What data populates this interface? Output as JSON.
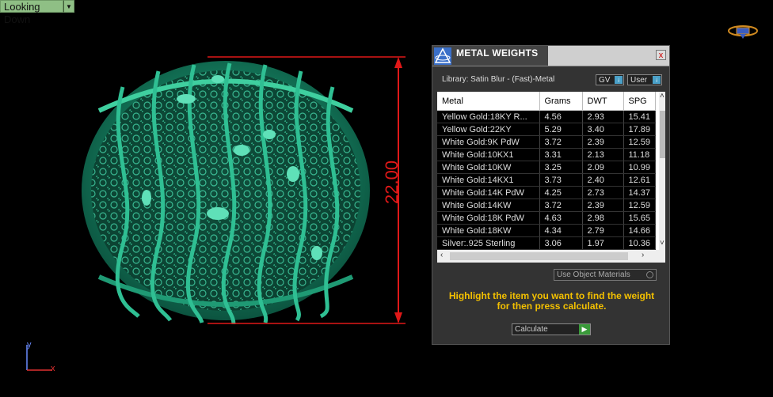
{
  "viewport": {
    "view_label": "Looking Down"
  },
  "dimension": {
    "value": "22.00"
  },
  "axis": {
    "y_label": "y",
    "x_label": "x"
  },
  "panel": {
    "title": "METAL WEIGHTS",
    "close_label": "x",
    "library": "Library: Satin Blur - (Fast)-Metal",
    "unit_select": "GV",
    "source_select": "User",
    "columns": [
      "Metal",
      "Grams",
      "DWT",
      "SPG"
    ],
    "rows": [
      [
        "Yellow Gold:18KY R...",
        "4.56",
        "2.93",
        "15.41"
      ],
      [
        "Yellow Gold:22KY",
        "5.29",
        "3.40",
        "17.89"
      ],
      [
        "White Gold:9K PdW",
        "3.72",
        "2.39",
        "12.59"
      ],
      [
        "White Gold:10KX1",
        "3.31",
        "2.13",
        "11.18"
      ],
      [
        "White Gold:10KW",
        "3.25",
        "2.09",
        "10.99"
      ],
      [
        "White Gold:14KX1",
        "3.73",
        "2.40",
        "12.61"
      ],
      [
        "White Gold:14K PdW",
        "4.25",
        "2.73",
        "14.37"
      ],
      [
        "White Gold:14KW",
        "3.72",
        "2.39",
        "12.59"
      ],
      [
        "White Gold:18K PdW",
        "4.63",
        "2.98",
        "15.65"
      ],
      [
        "White Gold:18KW",
        "4.34",
        "2.79",
        "14.66"
      ],
      [
        "Silver:.925 Sterling",
        "3.06",
        "1.97",
        "10.36"
      ]
    ],
    "use_object_materials": "Use Object Materials",
    "hint": "Highlight the item you want to find the weight for then press calculate.",
    "calculate_label": "Calculate"
  },
  "colors": {
    "ring": "#1a8a6a",
    "dimension": "#e01818",
    "hint": "#f3c000"
  }
}
